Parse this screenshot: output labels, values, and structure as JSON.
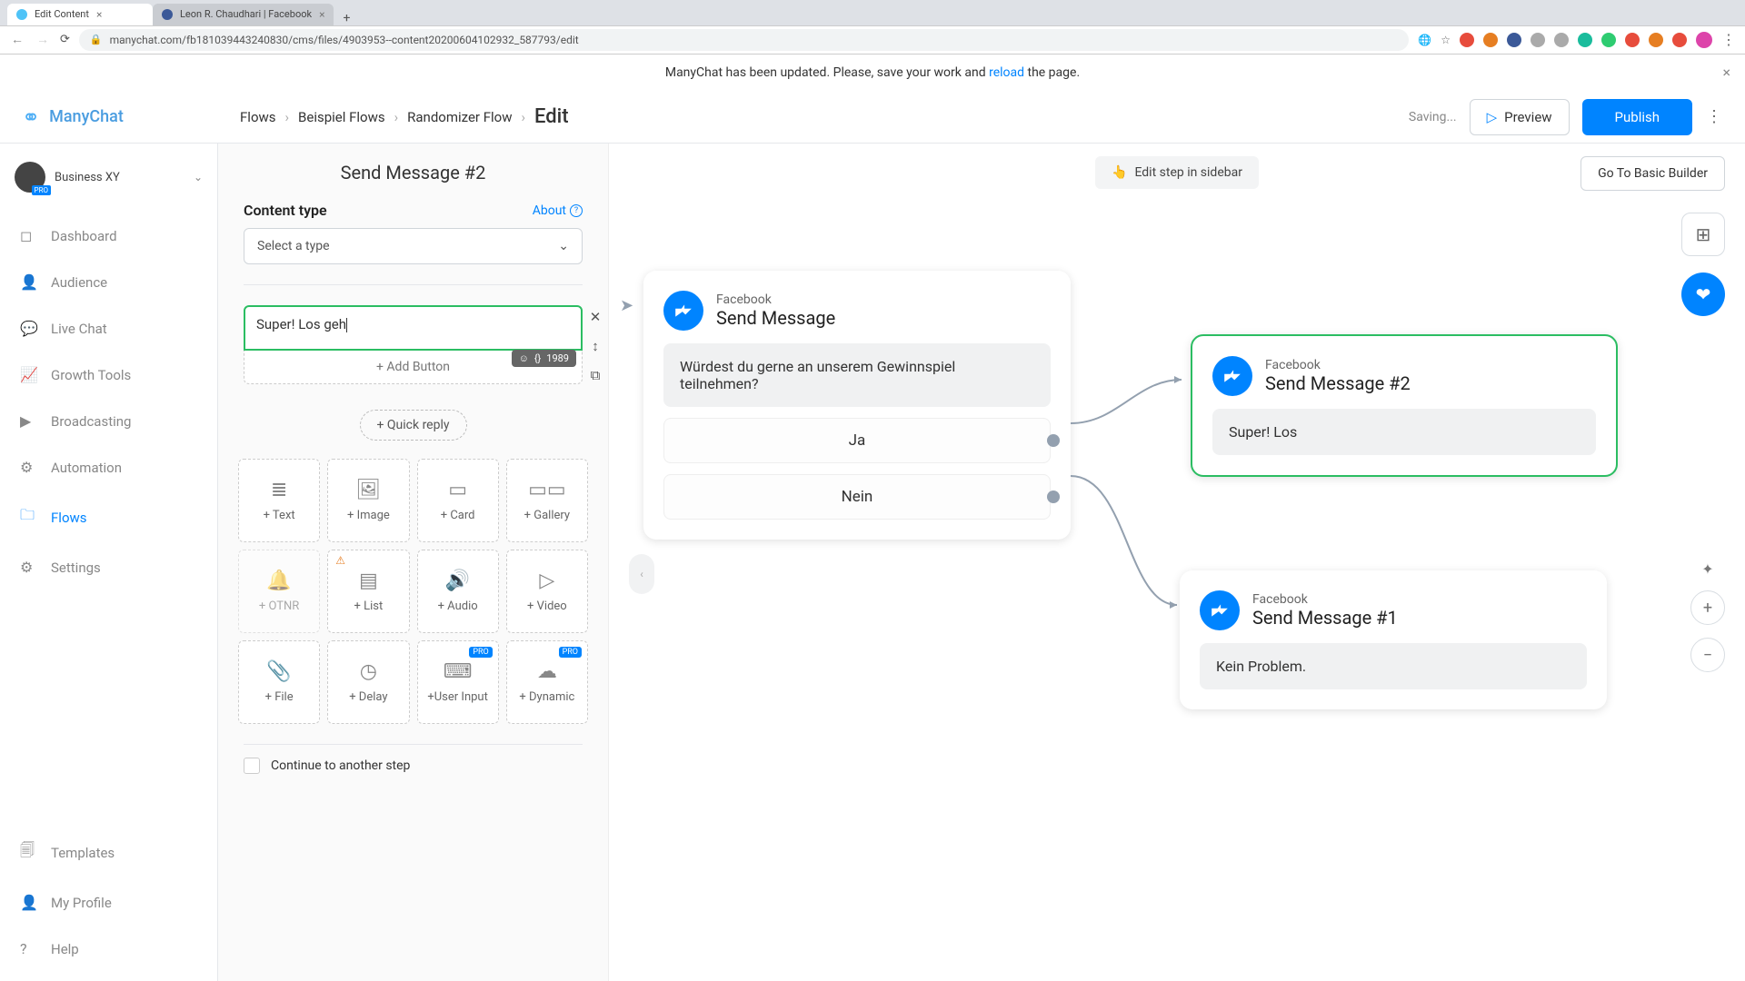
{
  "browser": {
    "tabs": [
      {
        "title": "Edit Content",
        "active": true
      },
      {
        "title": "Leon R. Chaudhari | Facebook",
        "active": false
      }
    ],
    "url": "manychat.com/fb181039443240830/cms/files/4903953--content20200604102932_587793/edit"
  },
  "notification": {
    "pre": "ManyChat has been updated. Please, save your work and ",
    "link": "reload",
    "post": " the page."
  },
  "logo": "ManyChat",
  "breadcrumbs": [
    "Flows",
    "Beispiel Flows",
    "Randomizer Flow"
  ],
  "breadcrumb_current": "Edit",
  "header": {
    "saving": "Saving...",
    "preview": "Preview",
    "publish": "Publish"
  },
  "sidebar": {
    "account": "Business XY",
    "pro": "PRO",
    "items": [
      {
        "label": "Dashboard",
        "icon": "◻"
      },
      {
        "label": "Audience",
        "icon": "👤"
      },
      {
        "label": "Live Chat",
        "icon": "💬"
      },
      {
        "label": "Growth Tools",
        "icon": "📈"
      },
      {
        "label": "Broadcasting",
        "icon": "▶"
      },
      {
        "label": "Automation",
        "icon": "⚙"
      },
      {
        "label": "Flows",
        "icon": "🗀",
        "active": true
      },
      {
        "label": "Settings",
        "icon": "⚙"
      }
    ],
    "bottom": [
      {
        "label": "Templates",
        "icon": "🗐"
      },
      {
        "label": "My Profile",
        "icon": "👤"
      },
      {
        "label": "Help",
        "icon": "?"
      }
    ]
  },
  "editor": {
    "title": "Send Message #2",
    "content_type_label": "Content type",
    "about": "About",
    "select_placeholder": "Select a type",
    "text_value": "Super! Los geh",
    "char_count": "1989",
    "add_button": "+ Add Button",
    "quick_reply": "+ Quick reply",
    "tiles": [
      {
        "label": "+ Text",
        "icon": "≣"
      },
      {
        "label": "+ Image",
        "icon": "🖼"
      },
      {
        "label": "+ Card",
        "icon": "▭"
      },
      {
        "label": "+ Gallery",
        "icon": "▭▭"
      },
      {
        "label": "+ OTNR",
        "icon": "🔔",
        "disabled": true
      },
      {
        "label": "+ List",
        "icon": "▤",
        "alert": true
      },
      {
        "label": "+ Audio",
        "icon": "🔊"
      },
      {
        "label": "+ Video",
        "icon": "▷"
      },
      {
        "label": "+ File",
        "icon": "📎"
      },
      {
        "label": "+ Delay",
        "icon": "◷"
      },
      {
        "label": "+User Input",
        "icon": "⌨",
        "pro": true
      },
      {
        "label": "+ Dynamic",
        "icon": "☁",
        "pro": true
      }
    ],
    "continue_label": "Continue to another step"
  },
  "canvas": {
    "edit_hint": "Edit step in sidebar",
    "go_basic": "Go To Basic Builder",
    "nodes": {
      "n1": {
        "kicker": "Facebook",
        "title": "Send Message",
        "bubble": "Würdest du gerne an unserem Gewinnspiel teilnehmen?",
        "buttons": [
          "Ja",
          "Nein"
        ]
      },
      "n2": {
        "kicker": "Facebook",
        "title": "Send Message #2",
        "bubble": "Super! Los"
      },
      "n3": {
        "kicker": "Facebook",
        "title": "Send Message #1",
        "bubble": "Kein Problem."
      }
    }
  }
}
